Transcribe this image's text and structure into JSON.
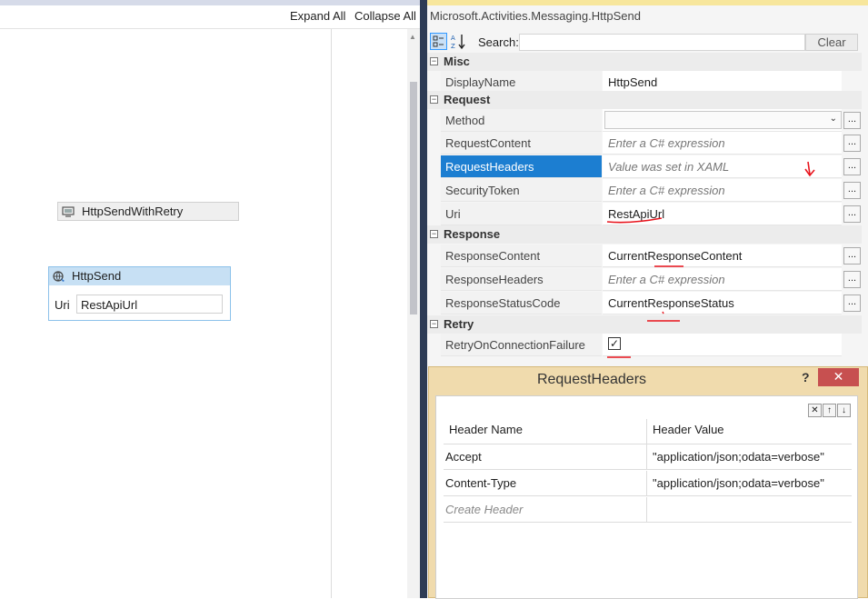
{
  "designer": {
    "toolbar": {
      "expand_all": "Expand All",
      "collapse_all": "Collapse All"
    },
    "activities": {
      "retry": {
        "title": "HttpSendWithRetry",
        "icon": "activity-box-icon"
      },
      "send": {
        "title": "HttpSend",
        "icon": "http-send-icon",
        "uri_label": "Uri",
        "uri_value": "RestApiUrl"
      }
    }
  },
  "properties": {
    "type_name": "Microsoft.Activities.Messaging.HttpSend",
    "toolbar": {
      "search_label": "Search:",
      "search_value": "",
      "clear_label": "Clear"
    },
    "categories": [
      {
        "name": "Misc",
        "toggle": "⊟",
        "rows": [
          {
            "name": "DisplayName",
            "value": "HttpSend",
            "kind": "text"
          }
        ]
      },
      {
        "name": "Request",
        "toggle": "⊟",
        "rows": [
          {
            "name": "Method",
            "value": "",
            "kind": "combo"
          },
          {
            "name": "RequestContent",
            "value": "Enter a C# expression",
            "kind": "hint"
          },
          {
            "name": "RequestHeaders",
            "value": "Value was set in XAML",
            "kind": "hint",
            "selected": true
          },
          {
            "name": "SecurityToken",
            "value": "Enter a C# expression",
            "kind": "hint"
          },
          {
            "name": "Uri",
            "value": "RestApiUrl",
            "kind": "text"
          }
        ]
      },
      {
        "name": "Response",
        "toggle": "⊟",
        "rows": [
          {
            "name": "ResponseContent",
            "value": "CurrentResponseContent",
            "kind": "text"
          },
          {
            "name": "ResponseHeaders",
            "value": "Enter a C# expression",
            "kind": "hint"
          },
          {
            "name": "ResponseStatusCode",
            "value": "CurrentResponseStatus",
            "kind": "text"
          }
        ]
      },
      {
        "name": "Retry",
        "toggle": "⊟",
        "rows": [
          {
            "name": "RetryOnConnectionFailure",
            "value": "checked",
            "kind": "checkbox"
          }
        ]
      }
    ],
    "ellipsis": "..."
  },
  "dialog": {
    "title": "RequestHeaders",
    "help": "?",
    "close": "✕",
    "grid": {
      "columns": [
        "Header Name",
        "Header Value"
      ],
      "rows": [
        {
          "name": "Accept",
          "value": "\"application/json;odata=verbose\""
        },
        {
          "name": "Content-Type",
          "value": "\"application/json;odata=verbose\""
        }
      ],
      "placeholder": "Create Header"
    },
    "tools": {
      "delete": "✕",
      "up": "↑",
      "down": "↓"
    }
  },
  "annotation_color": "#e8141d"
}
